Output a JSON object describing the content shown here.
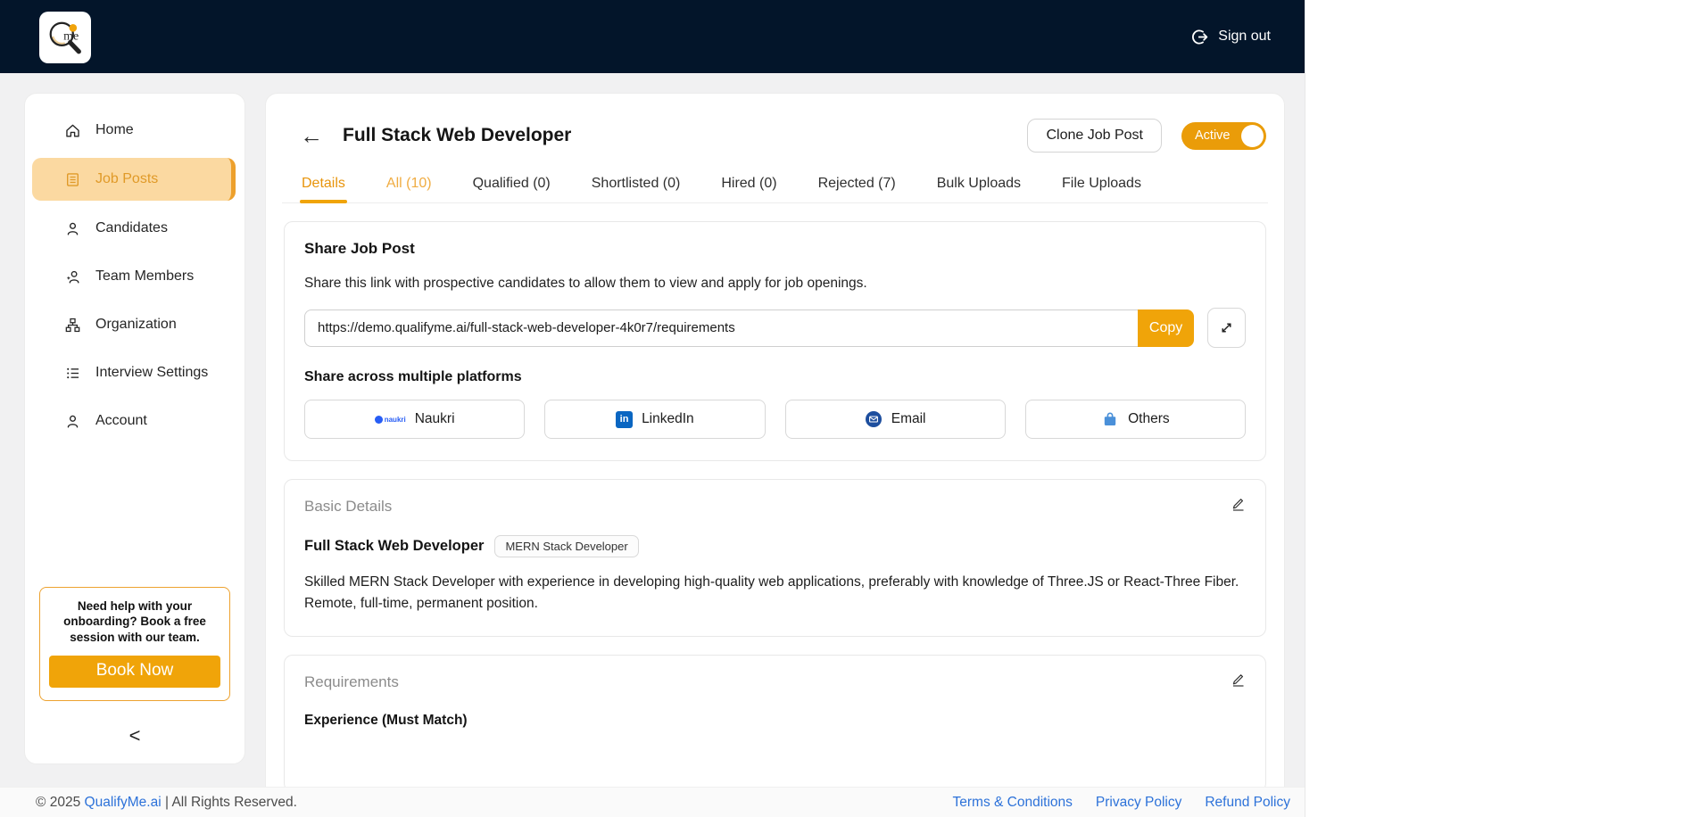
{
  "colors": {
    "accent_orange": "#F0A409",
    "topbar_navy": "#03152A",
    "active_item_bg": "#FBD9A1",
    "link_blue": "#2D72D9",
    "linkedin_blue": "#0A66C2",
    "email_blue": "#1D4E9E",
    "others_blue": "#4A90D9",
    "naukri_blue": "#275DF5"
  },
  "topbar": {
    "logo_text": "me",
    "sign_out_label": "Sign out"
  },
  "sidebar": {
    "items": [
      {
        "label": "Home",
        "icon": "home"
      },
      {
        "label": "Job Posts",
        "icon": "job-posts",
        "active": true
      },
      {
        "label": "Candidates",
        "icon": "person"
      },
      {
        "label": "Team Members",
        "icon": "people"
      },
      {
        "label": "Organization",
        "icon": "org-chart"
      },
      {
        "label": "Interview Settings",
        "icon": "list"
      },
      {
        "label": "Account",
        "icon": "person"
      }
    ],
    "help": {
      "text": "Need help with your onboarding? Book a free session with our team.",
      "cta_label": "Book Now"
    },
    "collapse_glyph": "<"
  },
  "header": {
    "back_glyph": "←",
    "title": "Full Stack Web Developer",
    "clone_button_label": "Clone Job Post",
    "status_toggle_label": "Active"
  },
  "tabs": [
    {
      "label": "Details",
      "state": "active"
    },
    {
      "label": "All (10)",
      "state": "accent"
    },
    {
      "label": "Qualified (0)",
      "state": "normal"
    },
    {
      "label": "Shortlisted (0)",
      "state": "normal"
    },
    {
      "label": "Hired (0)",
      "state": "normal"
    },
    {
      "label": "Rejected (7)",
      "state": "normal"
    },
    {
      "label": "Bulk Uploads",
      "state": "normal"
    },
    {
      "label": "File Uploads",
      "state": "normal"
    }
  ],
  "share": {
    "title": "Share Job Post",
    "description": "Share this link with prospective candidates to allow them to view and apply for job openings.",
    "url": "https://demo.qualifyme.ai/full-stack-web-developer-4k0r7/requirements",
    "copy_label": "Copy",
    "platforms_title": "Share across multiple platforms",
    "platforms": [
      {
        "label": "Naukri",
        "icon": "naukri-icon",
        "logo_text": "naukri"
      },
      {
        "label": "LinkedIn",
        "icon": "linkedin-icon",
        "logo_text": "in"
      },
      {
        "label": "Email",
        "icon": "email-icon"
      },
      {
        "label": "Others",
        "icon": "bag-icon"
      }
    ]
  },
  "basic_details": {
    "section_title": "Basic Details",
    "job_title": "Full Stack Web Developer",
    "badge": "MERN Stack Developer",
    "description": "Skilled MERN Stack Developer with experience in developing high-quality web applications, preferably with knowledge of Three.JS or React-Three Fiber. Remote, full-time, permanent position."
  },
  "requirements": {
    "section_title": "Requirements",
    "subsection_title": "Experience (Must Match)"
  },
  "footer": {
    "copyright_prefix": "© 2025 ",
    "brand_link": "QualifyMe.ai",
    "copyright_suffix": " | All Rights Reserved.",
    "links": [
      {
        "label": "Terms & Conditions"
      },
      {
        "label": "Privacy Policy"
      },
      {
        "label": "Refund Policy"
      }
    ]
  }
}
